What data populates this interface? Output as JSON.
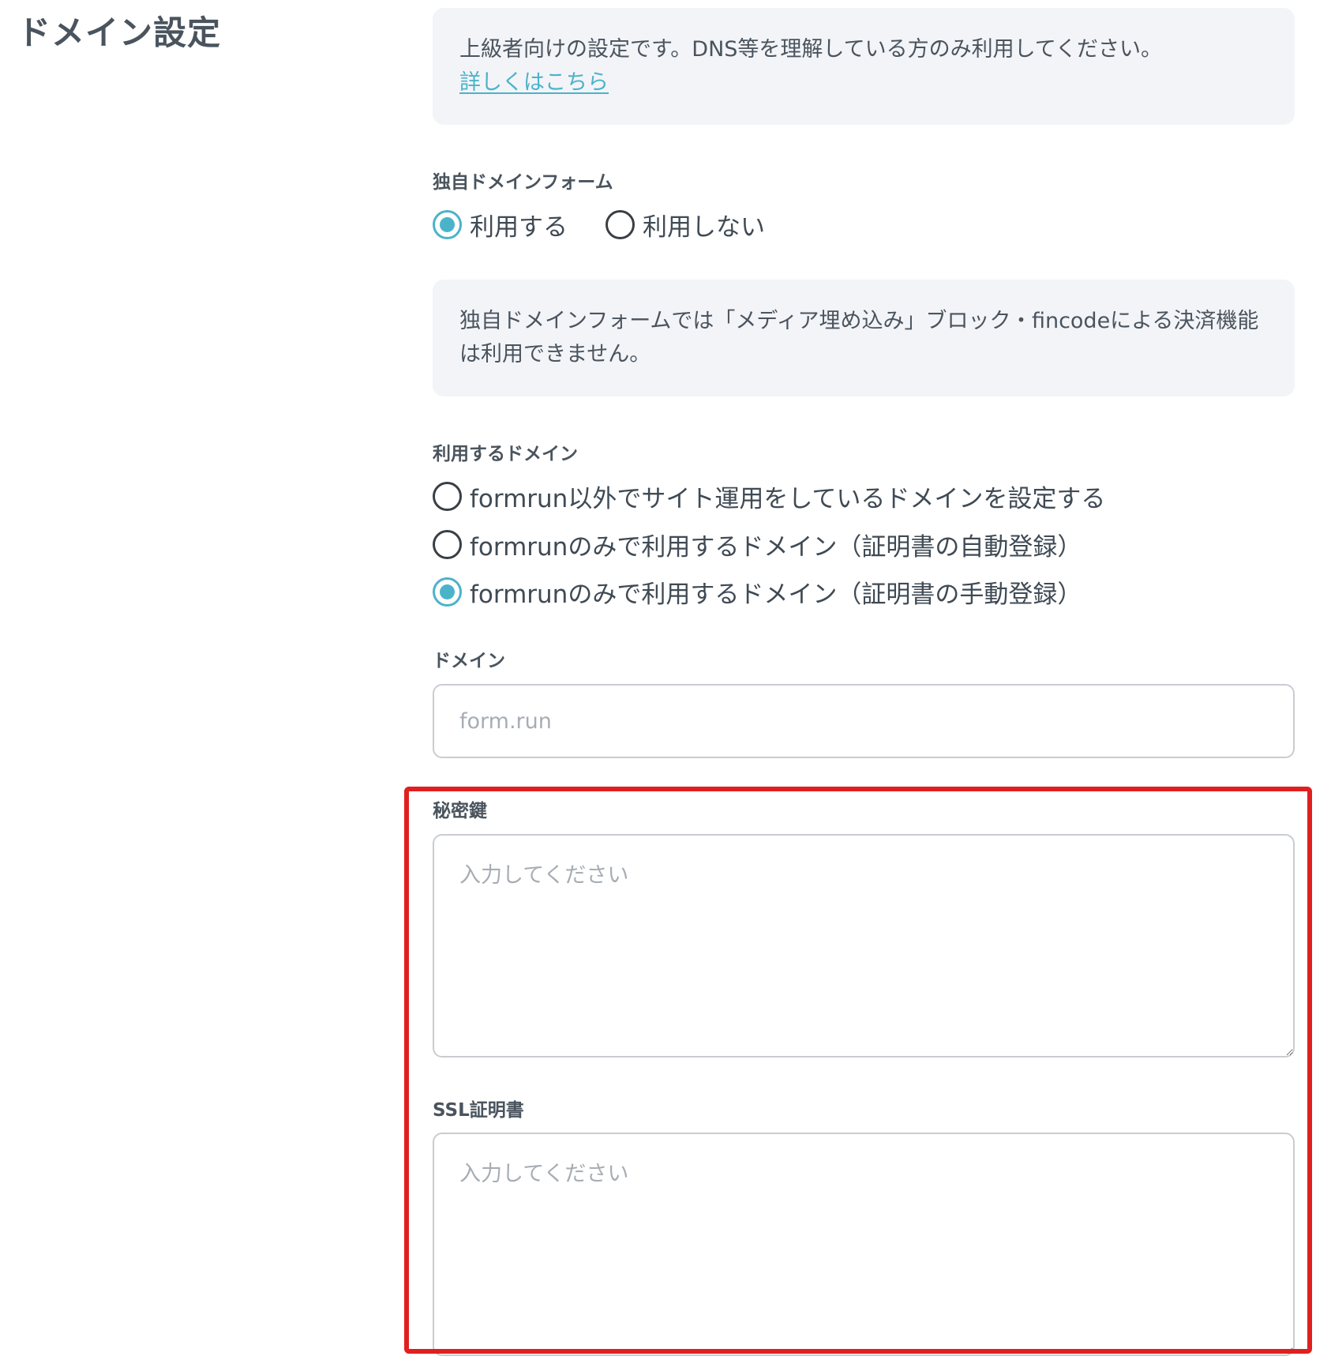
{
  "section": {
    "title": "ドメイン設定"
  },
  "notice_advanced": {
    "text": "上級者向けの設定です。DNS等を理解している方のみ利用してください。",
    "link_label": "詳しくはこちら"
  },
  "custom_domain_form": {
    "label": "独自ドメインフォーム",
    "options": [
      {
        "label": "利用する",
        "checked": true
      },
      {
        "label": "利用しない",
        "checked": false
      }
    ]
  },
  "notice_restriction": {
    "text": "独自ドメインフォームでは「メディア埋め込み」ブロック・fincodeによる決済機能は利用できません。"
  },
  "domain_type": {
    "label": "利用するドメイン",
    "options": [
      {
        "label": "formrun以外でサイト運用をしているドメインを設定する",
        "checked": false
      },
      {
        "label": "formrunのみで利用するドメイン（証明書の自動登録）",
        "checked": false
      },
      {
        "label": "formrunのみで利用するドメイン（証明書の手動登録）",
        "checked": true
      }
    ]
  },
  "domain": {
    "label": "ドメイン",
    "placeholder": "form.run",
    "value": ""
  },
  "private_key": {
    "label": "秘密鍵",
    "placeholder": "入力してください",
    "value": ""
  },
  "ssl_certificate": {
    "label": "SSL証明書",
    "placeholder": "入力してください",
    "value": ""
  },
  "colors": {
    "accent": "#4bb3c9",
    "highlight": "#e02020",
    "notice_bg": "#f3f4f8",
    "text": "#3f4a54"
  }
}
